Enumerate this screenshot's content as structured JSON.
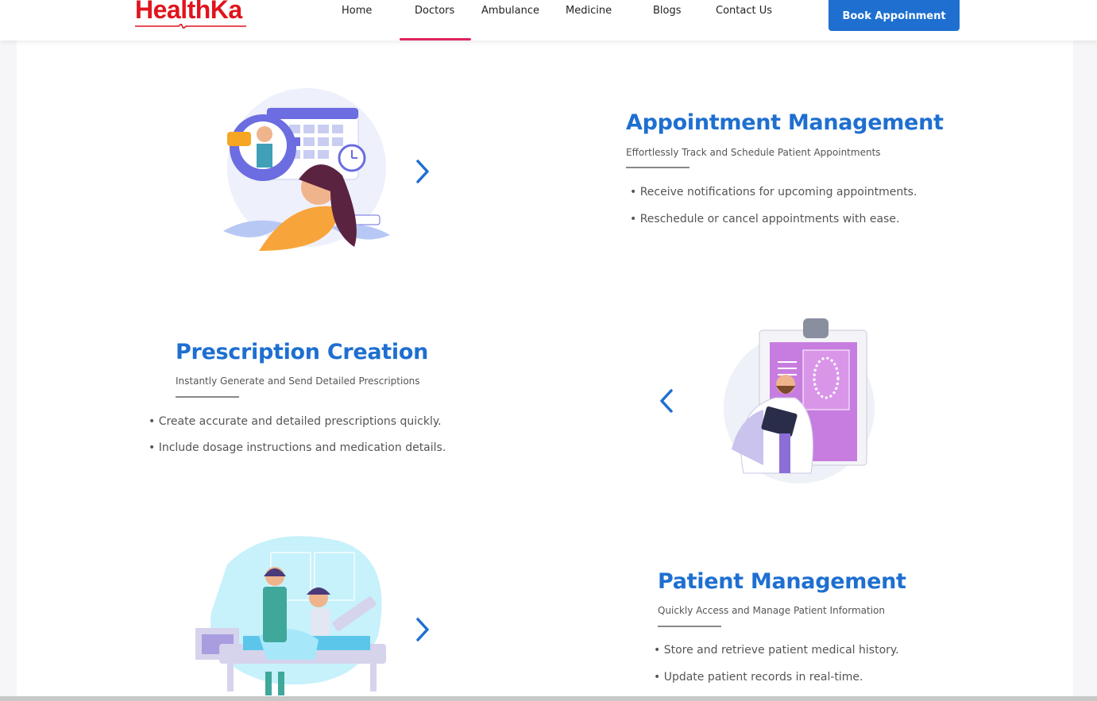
{
  "brand": {
    "name": "HealthKa",
    "color": "#e0141d"
  },
  "nav": {
    "items": [
      {
        "label": "Home"
      },
      {
        "label": "Doctors",
        "active": true
      },
      {
        "label": "Ambulance"
      },
      {
        "label": "Medicine"
      },
      {
        "label": "Blogs"
      },
      {
        "label": "Contact Us"
      }
    ],
    "active_color": "#e0245e"
  },
  "cta": {
    "label": "Book Appoinment",
    "color": "#1e6fd0"
  },
  "features": [
    {
      "title": "Appointment Management",
      "subtitle": "Effortlessly Track and Schedule Patient Appointments",
      "bullets": [
        "• Receive notifications for upcoming appointments.",
        "• Reschedule or cancel appointments with ease."
      ],
      "illustration_icon": "calendar-consultation-illustration",
      "arrow_icon": "chevron-right-icon"
    },
    {
      "title": "Prescription Creation",
      "subtitle": "Instantly Generate and Send Detailed Prescriptions",
      "bullets": [
        "• Create accurate and detailed prescriptions quickly.",
        "• Include dosage instructions and medication details."
      ],
      "illustration_icon": "doctor-clipboard-illustration",
      "arrow_icon": "chevron-left-icon"
    },
    {
      "title": "Patient Management",
      "subtitle": "Quickly Access and Manage Patient Information",
      "bullets": [
        "• Store and retrieve patient medical history.",
        "• Update patient records in real-time."
      ],
      "illustration_icon": "nurse-patient-bed-illustration",
      "arrow_icon": "chevron-right-icon"
    }
  ],
  "colors": {
    "accent": "#1e6fd0",
    "text_muted": "#555555"
  }
}
